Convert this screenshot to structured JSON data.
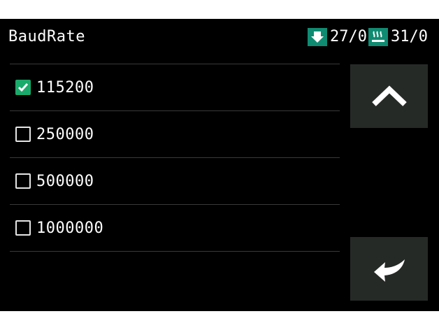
{
  "header": {
    "title": "BaudRate",
    "extruder_icon": "extruder-nozzle-icon",
    "extruder_temp": "27/0",
    "bed_icon": "heated-bed-icon",
    "bed_temp": "31/0"
  },
  "options": [
    {
      "label": "115200",
      "checked": true
    },
    {
      "label": "250000",
      "checked": false
    },
    {
      "label": "500000",
      "checked": false
    },
    {
      "label": "1000000",
      "checked": false
    }
  ],
  "buttons": {
    "up_icon": "chevron-up-icon",
    "back_icon": "return-arrow-icon"
  },
  "colors": {
    "background": "#000000",
    "accent": "#0f8b72",
    "check": "#1aaa6b",
    "button": "#262a27",
    "divider": "#3a3a3a"
  }
}
